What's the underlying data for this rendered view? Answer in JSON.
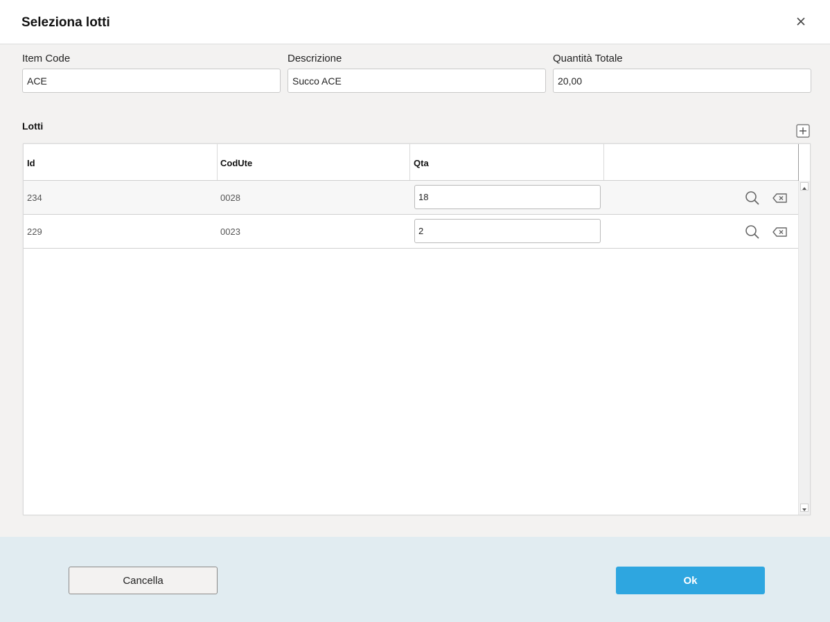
{
  "dialog": {
    "title": "Seleziona lotti"
  },
  "fields": {
    "item_code": {
      "label": "Item Code",
      "value": "ACE"
    },
    "descrizione": {
      "label": "Descrizione",
      "value": "Succo ACE"
    },
    "quantita_totale": {
      "label": "Quantità Totale",
      "value": "20,00"
    }
  },
  "lotti": {
    "label": "Lotti",
    "columns": [
      "Id",
      "CodUte",
      "Qta",
      ""
    ],
    "rows": [
      {
        "id": "234",
        "codute": "0028",
        "qta": "18"
      },
      {
        "id": "229",
        "codute": "0023",
        "qta": "2"
      }
    ]
  },
  "footer": {
    "cancel_label": "Cancella",
    "ok_label": "Ok"
  },
  "icons": {
    "close": "close-icon",
    "add": "plus-box-icon",
    "search": "search-icon",
    "delete": "backspace-icon"
  },
  "colors": {
    "accent": "#2ea6e0",
    "footer_bg": "#e1ecf1",
    "body_bg": "#f3f2f1"
  }
}
